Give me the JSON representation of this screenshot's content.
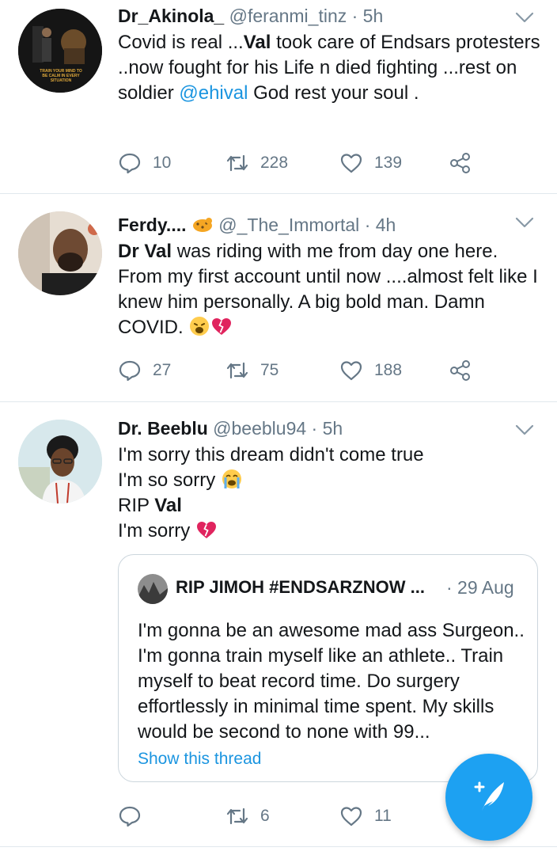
{
  "tweets": [
    {
      "name": "Dr_Akinola_",
      "handle": "@feranmi_tinz",
      "time": "· 5h",
      "text_parts": [
        "Covid is real ...",
        "Val",
        " took care of Endsars protesters ..now fought for his Life n died fighting ...rest on soldier ",
        "@ehival",
        " God rest your soul ."
      ],
      "avatar_text": "TRAIN YOUR MIND TO BE CALM IN EVERY SITUATION",
      "replies": "10",
      "retweets": "228",
      "likes": "139"
    },
    {
      "name": "Ferdy....",
      "handle": "@_The_Immortal",
      "time": "· 4h",
      "text_parts": [
        "Dr Val",
        " was riding with me from day one here. From my first account until now ....almost felt like I knew him personally. A big bold man. Damn COVID. "
      ],
      "replies": "27",
      "retweets": "75",
      "likes": "188"
    },
    {
      "name": "Dr. Beeblu",
      "handle": "@beeblu94",
      "time": "· 5h",
      "lines": [
        "I'm sorry this dream didn't come true",
        "I'm so sorry ",
        "RIP ",
        "Val",
        "I'm sorry "
      ],
      "retweets": "6",
      "likes": "11"
    }
  ],
  "quote": {
    "name": "RIP JIMOH #ENDSARZNOW ...",
    "date": "· 29 Aug",
    "text": "I'm gonna be an awesome mad ass Surgeon.. I'm gonna train myself like an athlete.. Train myself to beat record time. Do surgery effortlessly in minimal time spent. My skills would be second to none with 99...",
    "link": "Show this thread"
  },
  "icons": {
    "reply": "reply-icon",
    "retweet": "retweet-icon",
    "like": "like-icon",
    "share": "share-icon",
    "more": "chevron-down-icon",
    "compose": "compose-tweet-icon"
  },
  "colors": {
    "accent": "#1da1f2",
    "link": "#1b95e0",
    "muted": "#657786",
    "broken_heart": "#e0245e"
  }
}
